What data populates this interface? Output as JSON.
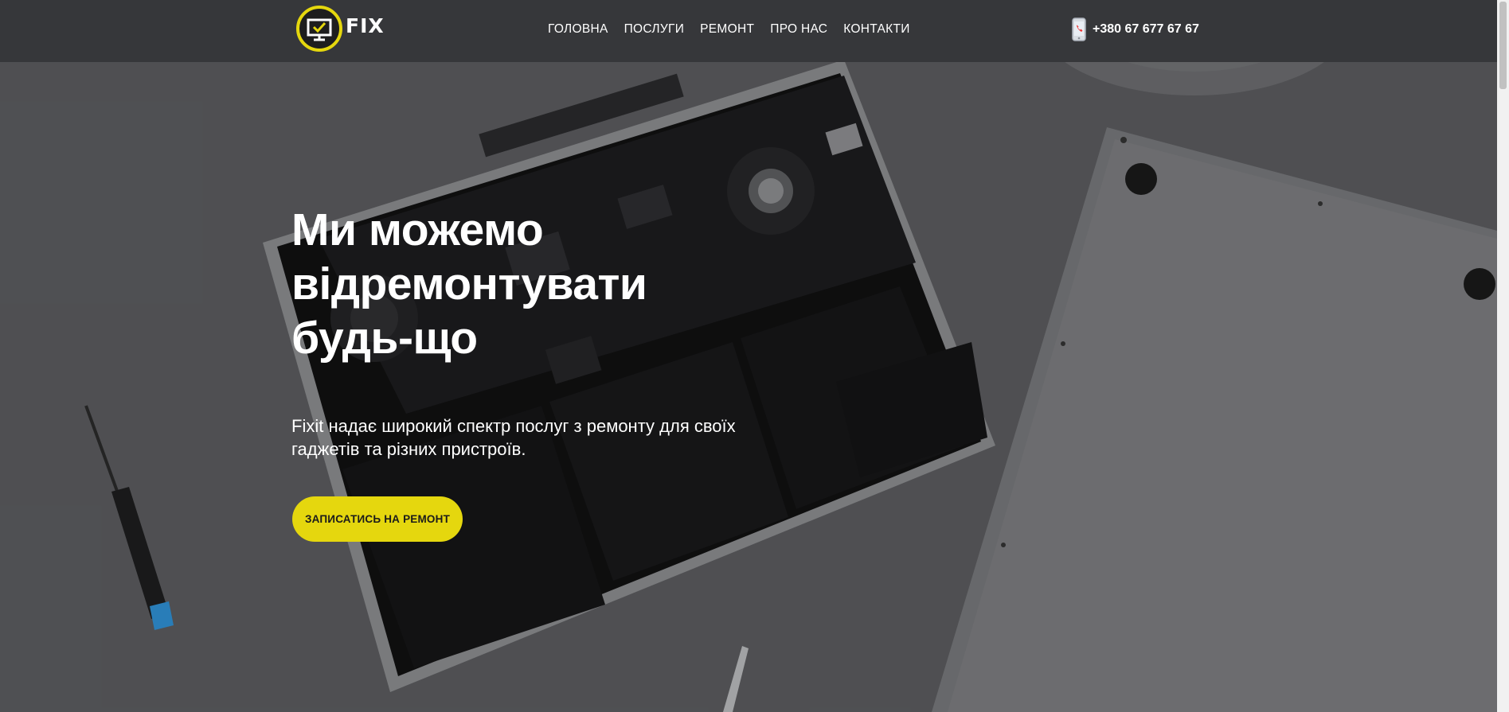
{
  "header": {
    "logo_text": "FIX",
    "nav": [
      "ГОЛОВНА",
      "ПОСЛУГИ",
      "РЕМОНТ",
      "ПРО НАС",
      "КОНТАКТИ"
    ],
    "phone": "+380 67 677 67 67"
  },
  "hero": {
    "title_line1": "Ми можемо",
    "title_line2": "відремонтувати",
    "title_line3": "будь-що",
    "subtitle": "Fixit надає широкий спектр послуг з ремонту для своїх гаджетів та різних пристроїв.",
    "cta_label": "ЗАПИСАТИСЬ НА РЕМОНТ"
  },
  "colors": {
    "accent": "#e5d70e",
    "header_bg": "#36373a"
  }
}
